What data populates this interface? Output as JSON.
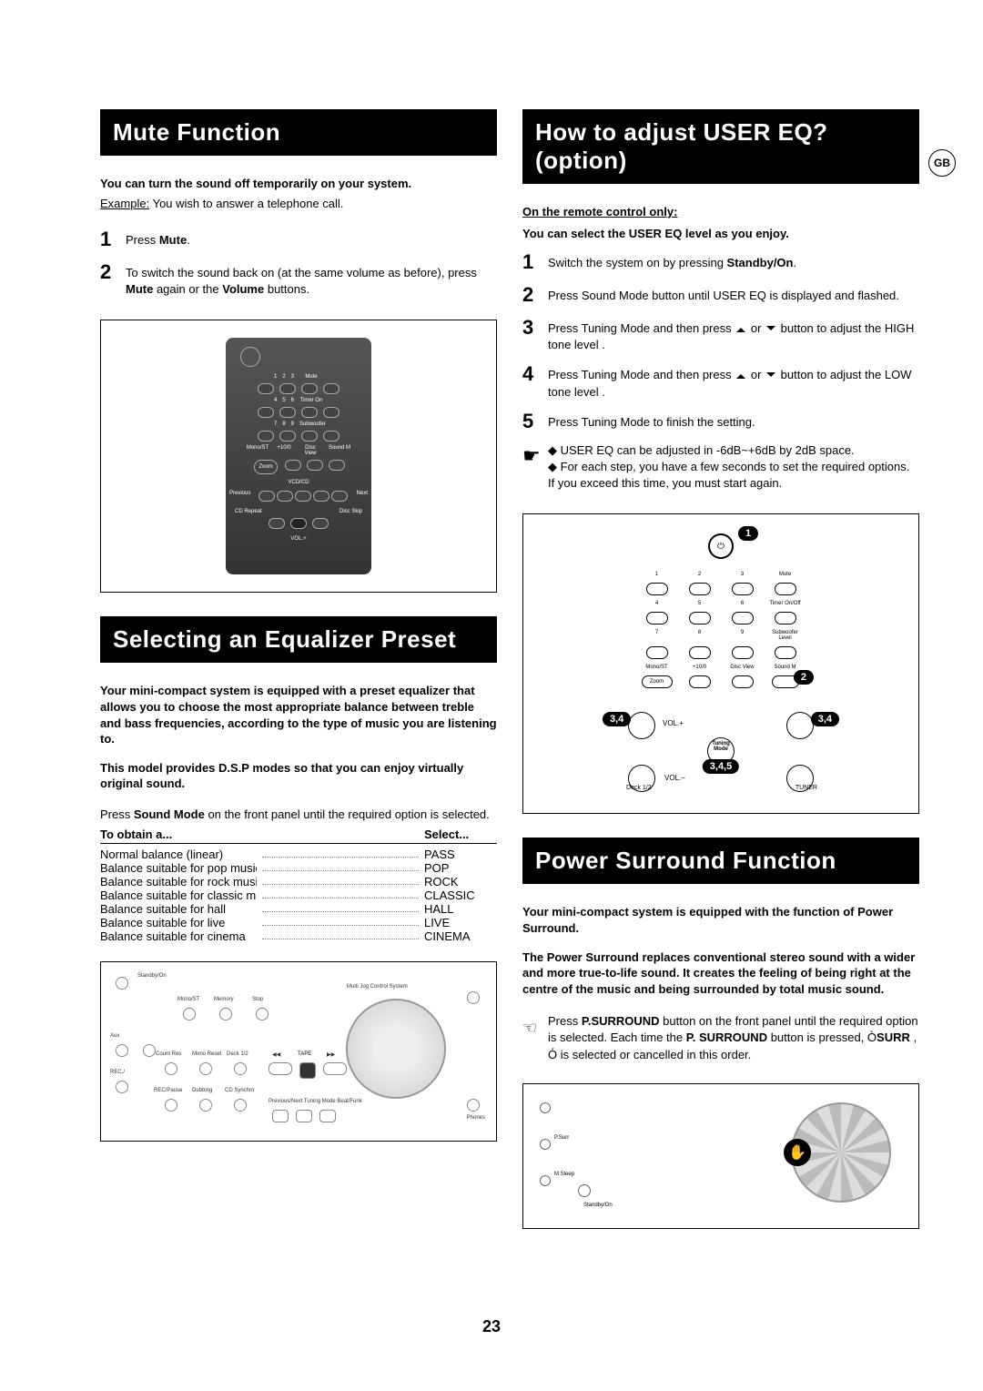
{
  "left": {
    "mute": {
      "header": "Mute Function",
      "intro": "You can turn the sound off temporarily on your system.",
      "example_label": "Example:",
      "example": "You wish to answer a telephone call.",
      "steps": [
        {
          "n": "1",
          "pre": "Press ",
          "b1": "Mute",
          "post": "."
        },
        {
          "n": "2",
          "pre": "To switch the sound back on (at the same volume as before), press ",
          "b1": "Mute",
          "mid": " again or the ",
          "b2": "Volume",
          "post": " buttons."
        }
      ]
    },
    "eq": {
      "header": "Selecting an Equalizer Preset",
      "intro": "Your mini-compact system is equipped with a preset equalizer that allows you to choose the most appropriate balance between treble and bass frequencies, according to the type of music you are listening to.",
      "intro2": "This model provides D.S.P modes so that you can enjoy virtually original sound.",
      "instr_pre": "Press ",
      "instr_b": "Sound Mode",
      "instr_post": " on the front panel until the required option is selected.",
      "table_hdr_left": "To obtain a...",
      "table_hdr_right": "Select...",
      "rows": [
        {
          "l": "Normal balance (linear)",
          "r": "PASS"
        },
        {
          "l": "Balance suitable for pop music",
          "r": "POP"
        },
        {
          "l": "Balance suitable for rock music",
          "r": "ROCK"
        },
        {
          "l": "Balance suitable for classic music",
          "r": "CLASSIC"
        },
        {
          "l": "Balance suitable for hall",
          "r": "HALL"
        },
        {
          "l": "Balance suitable for live",
          "r": "LIVE"
        },
        {
          "l": "Balance suitable for cinema",
          "r": "CINEMA"
        }
      ]
    }
  },
  "right": {
    "usereq": {
      "header": "How to adjust USER EQ?(option)",
      "line1": "On the remote control only:",
      "line2": "You can select the USER EQ level as you enjoy.",
      "steps": [
        {
          "n": "1",
          "t": "Switch the system on by pressing ",
          "b": "Standby/On",
          "post": "."
        },
        {
          "n": "2",
          "t": "Press Sound Mode button until USER EQ is displayed and flashed."
        },
        {
          "n": "3",
          "t": "Press Tuning Mode and then press ",
          "arrows": true,
          "post": " button to adjust the HIGH tone level ."
        },
        {
          "n": "4",
          "t": "Press Tuning Mode and then press ",
          "arrows": true,
          "post": " button to adjust the LOW tone level ."
        },
        {
          "n": "5",
          "t": "Press Tuning Mode to finish the setting."
        }
      ],
      "note_marker": "☛",
      "bullet": "◆",
      "note1": "USER EQ can be adjusted  in -6dB~+6dB by 2dB space.",
      "note2": "For each step, you have a few seconds to set the required options. If you exceed this time, you must start again."
    },
    "psurr": {
      "header": "Power Surround Function",
      "intro": "Your mini-compact system is equipped with the function of Power Surround.",
      "desc": "The Power Surround replaces conventional stereo sound with a wider and more true-to-life sound. It creates the feeling of being right at the centre of the music and being surrounded by total music sound.",
      "step_pre": "Press ",
      "step_b1": "P.SURROUND",
      "step_mid1": " button on the front panel until the required option is selected. Each time the ",
      "step_b2": "P. SURROUND",
      "step_mid2": " button is pressed, Ò",
      "step_b3": "SURR",
      "step_post": " , Ó is selected or cancelled in this order."
    },
    "remote_labels": {
      "row1": [
        "1",
        "2",
        "3",
        "Mute"
      ],
      "row2": [
        "4",
        "5",
        "6",
        "Timer On/Off"
      ],
      "row3": [
        "7",
        "8",
        "9",
        "Subwoofer Level"
      ],
      "row4": [
        "Mono/ST",
        "+10/0",
        "Disc View",
        "Sound M"
      ],
      "zoom": "Zoom",
      "vol_up": "VOL.+",
      "vol_down": "VOL.−",
      "tuning": "Tuning Mode",
      "deck": "Deck 1/2",
      "tuner": "TUNER",
      "badges": {
        "b1": "1",
        "b2": "2",
        "b34a": "3,4",
        "b34b": "3,4",
        "b345": "3,4,5"
      }
    }
  },
  "page_number": "23",
  "gb": "GB"
}
